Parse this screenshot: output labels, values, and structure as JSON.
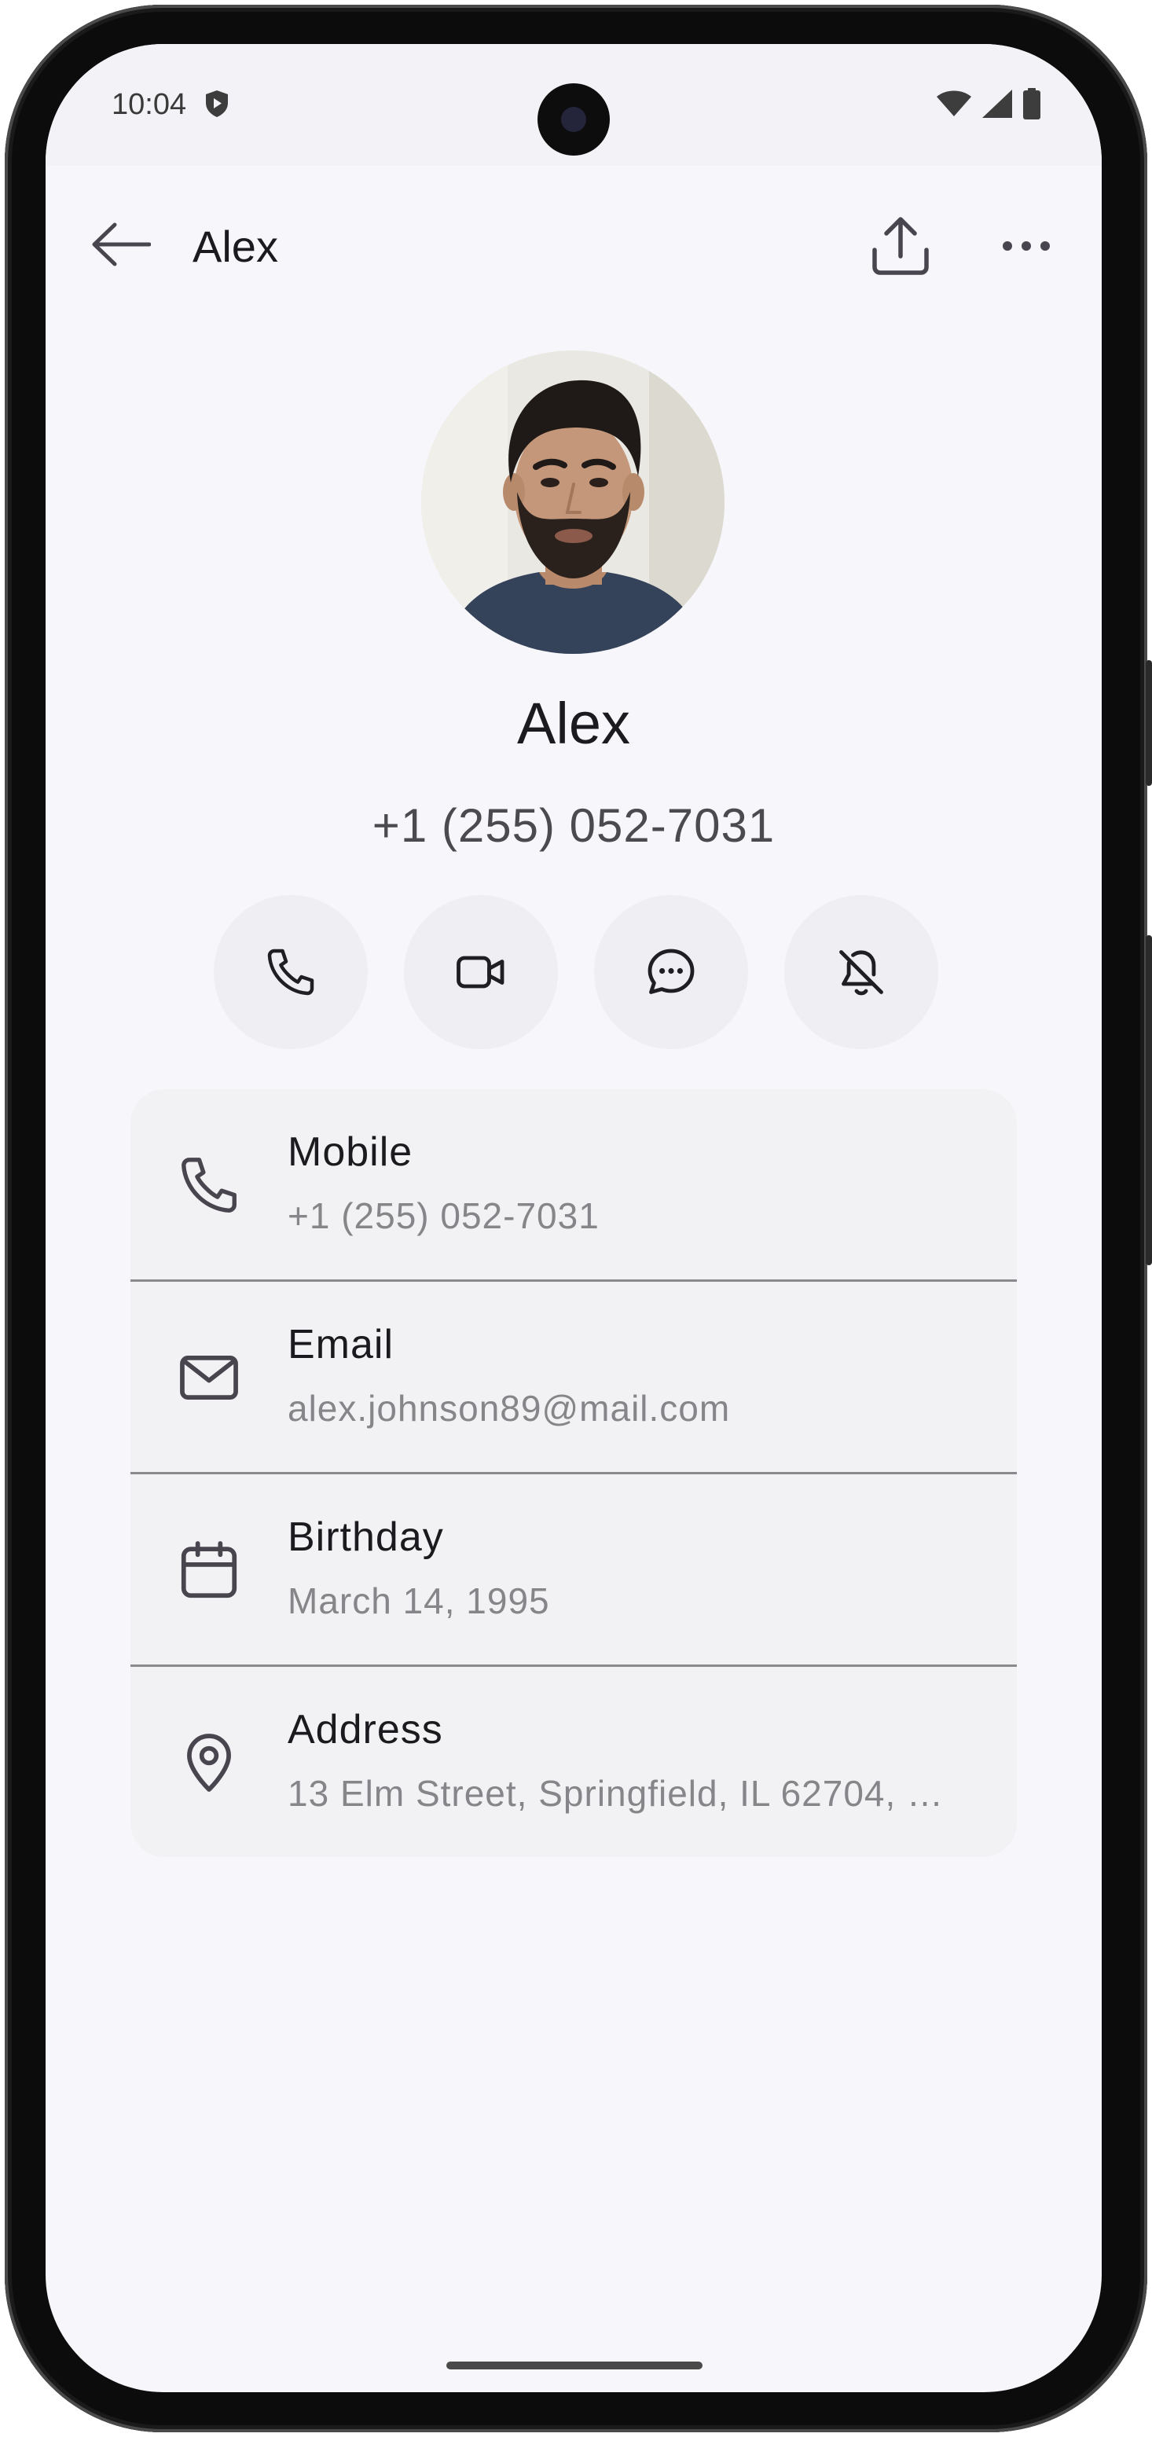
{
  "status_bar": {
    "time": "10:04"
  },
  "app_bar": {
    "title": "Alex"
  },
  "contact": {
    "name": "Alex",
    "phone": "+1 (255) 052-7031"
  },
  "details": [
    {
      "label": "Mobile",
      "value": "+1 (255) 052-7031",
      "icon": "phone-icon"
    },
    {
      "label": "Email",
      "value": "alex.johnson89@mail.com",
      "icon": "mail-icon"
    },
    {
      "label": "Birthday",
      "value": "March 14, 1995",
      "icon": "calendar-icon"
    },
    {
      "label": "Address",
      "value": "13 Elm Street, Springfield, IL 62704, …",
      "icon": "location-pin-icon"
    }
  ],
  "colors": {
    "screen_background": "#f7f6fb",
    "card_background": "#f2f2f4",
    "action_button_background": "#efeef2",
    "primary_text": "#1b1b1f",
    "secondary_text": "#85858a"
  },
  "icons": {
    "back": "arrow-left-icon",
    "share": "share-icon",
    "more": "more-horizontal-icon",
    "actions": [
      "phone-icon",
      "video-icon",
      "message-icon",
      "bell-off-icon"
    ]
  }
}
